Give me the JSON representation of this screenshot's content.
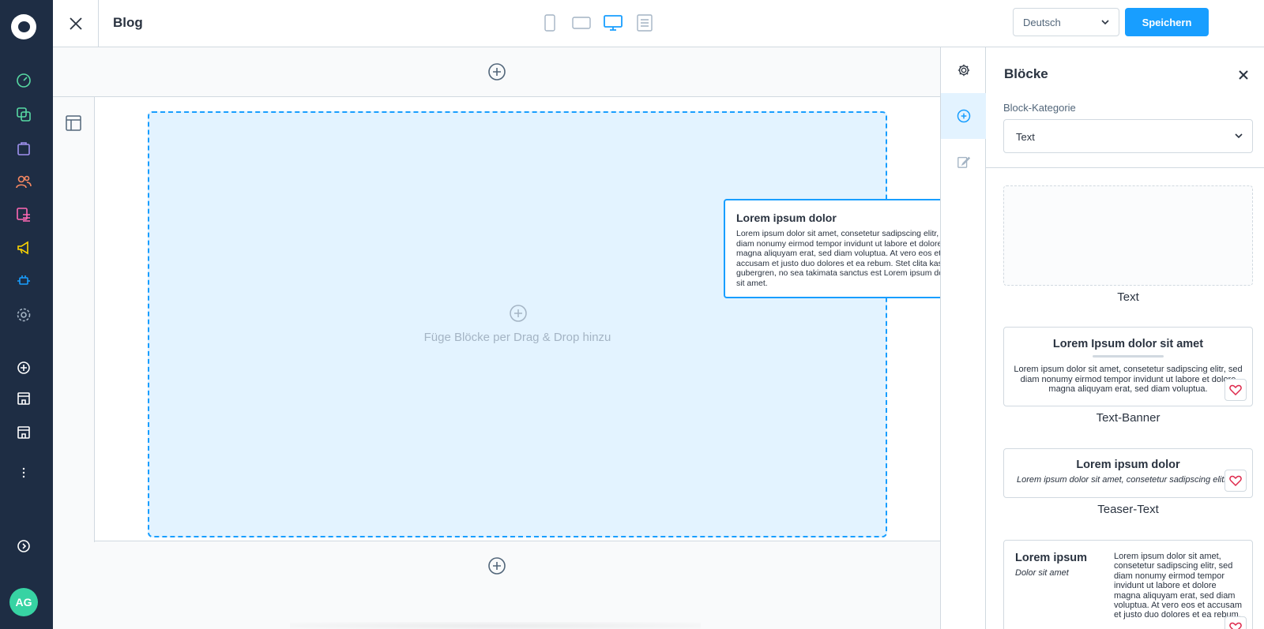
{
  "nav": {
    "avatar_initials": "AG",
    "icons": [
      "dashboard-icon",
      "catalog-icon",
      "orders-icon",
      "customers-icon",
      "content-icon",
      "marketing-icon",
      "extensions-icon",
      "settings-icon",
      "add-sales-channel-icon",
      "storefront-icon",
      "headless-icon",
      "more-icon",
      "help-icon"
    ],
    "colors": {
      "background": "#1e2d44",
      "dashboard": "#57d9a3",
      "catalog": "#57d9a3",
      "orders": "#a092f0",
      "customers": "#f88962",
      "content": "#ff68b4",
      "marketing": "#ffd700",
      "extensions": "#189eff"
    }
  },
  "topbar": {
    "title": "Blog",
    "language": "Deutsch",
    "save_label": "Speichern",
    "devices": [
      "mobile-icon",
      "tablet-icon",
      "desktop-icon",
      "form-icon"
    ],
    "active_device": "desktop-icon"
  },
  "canvas": {
    "dropzone_label": "Füge Blöcke per Drag & Drop hinzu"
  },
  "drag_preview": {
    "heading": "Lorem ipsum dolor",
    "body": "Lorem ipsum dolor sit amet, consetetur sadipscing elitr, sed diam nonumy eirmod tempor invidunt ut labore et dolore magna aliquyam erat, sed diam voluptua. At vero eos et accusam et justo duo dolores et ea rebum. Stet clita kasd gubergren, no sea takimata sanctus est Lorem ipsum dolor sit amet."
  },
  "side_tabs": [
    "settings-icon",
    "add-block-icon",
    "edit-icon"
  ],
  "panel": {
    "title": "Blöcke",
    "category_label": "Block-Kategorie",
    "category_value": "Text",
    "blocks": [
      {
        "name": "Text"
      },
      {
        "name": "Text-Banner",
        "heading": "Lorem Ipsum dolor sit amet",
        "body": "Lorem ipsum dolor sit amet, consetetur sadipscing elitr, sed diam nonumy eirmod tempor invidunt ut labore et dolore magna aliquyam erat, sed diam voluptua."
      },
      {
        "name": "Teaser-Text",
        "heading": "Lorem ipsum dolor",
        "body": "Lorem ipsum dolor sit amet, consetetur sadipscing elitr"
      },
      {
        "heading": "Lorem ipsum",
        "subheading": "Dolor sit amet",
        "body": "Lorem ipsum dolor sit amet, consetetur sadipscing elitr, sed diam nonumy eirmod tempor invidunt ut labore et dolore magna aliquyam erat, sed diam voluptua. At vero eos et accusam et justo duo dolores et ea rebum."
      }
    ]
  },
  "colors": {
    "primary": "#189eff",
    "dropzone_bg": "#e3f3ff",
    "favorite": "#de294c",
    "border": "#d1d9e0"
  }
}
